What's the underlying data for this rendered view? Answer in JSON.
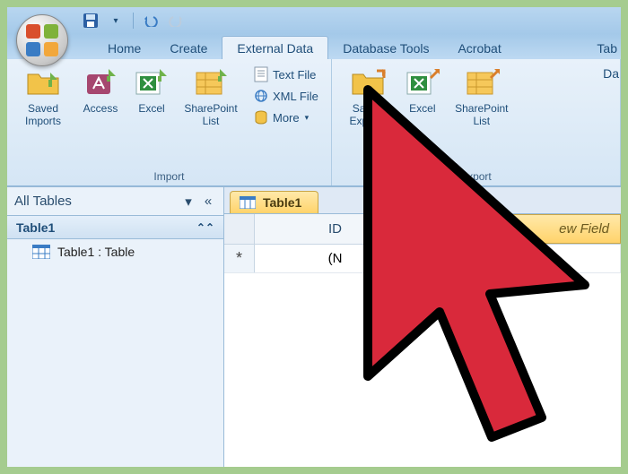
{
  "qat": {
    "save_title": "Save"
  },
  "tabs": {
    "home": "Home",
    "create": "Create",
    "external_data": "External Data",
    "database_tools": "Database Tools",
    "acrobat": "Acrobat",
    "truncated_tab": "Tab",
    "truncated_da": "Da"
  },
  "ribbon": {
    "import": {
      "label": "Import",
      "saved_imports": "Saved Imports",
      "access": "Access",
      "excel": "Excel",
      "sharepoint_list": "SharePoint List",
      "text_file": "Text File",
      "xml_file": "XML File",
      "more": "More"
    },
    "export": {
      "label": "Export",
      "saved_exports": "Saved Exports",
      "excel": "Excel",
      "sharepoint_list": "SharePoint List"
    }
  },
  "nav": {
    "header": "All Tables",
    "group": "Table1",
    "item": "Table1 : Table"
  },
  "doc": {
    "tab": "Table1",
    "col_id": "ID",
    "col_new": "ew Field",
    "new_row_marker": "*",
    "new_row_value": "(N"
  },
  "icons": {
    "dropdown": "▾",
    "collapse": "«",
    "expand_up": "⌃"
  },
  "colors": {
    "accent_blue": "#1f4e79",
    "ribbon_bg": "#e8f1fa",
    "highlight": "#ffd36b"
  }
}
